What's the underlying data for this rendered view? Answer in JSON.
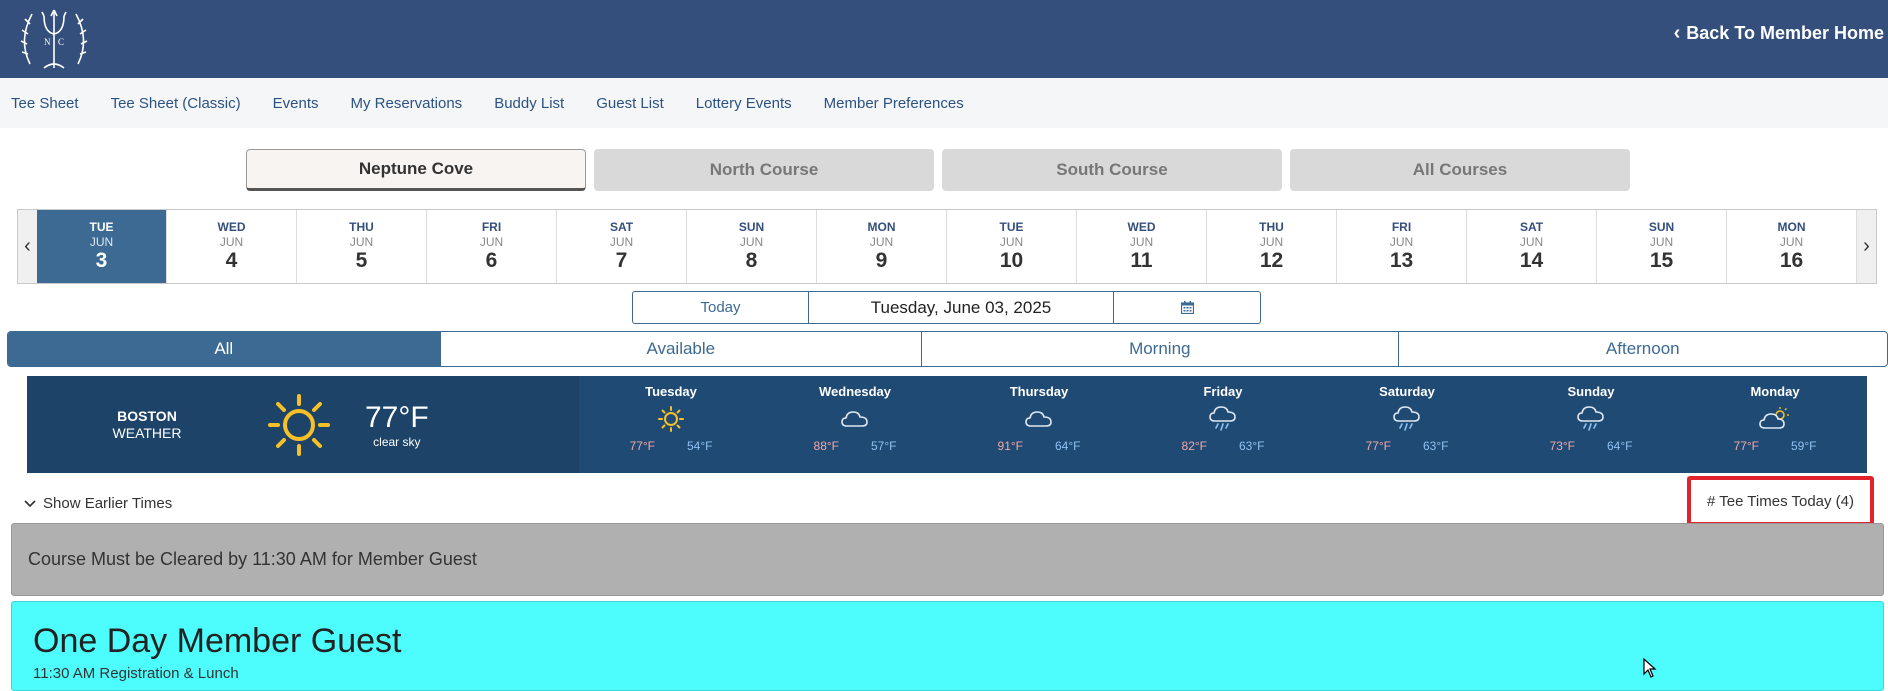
{
  "header": {
    "back_label": "Back To Member Home"
  },
  "nav": [
    "Tee Sheet",
    "Tee Sheet (Classic)",
    "Events",
    "My Reservations",
    "Buddy List",
    "Guest List",
    "Lottery Events",
    "Member Preferences"
  ],
  "courses": [
    "Neptune Cove",
    "North Course",
    "South Course",
    "All Courses"
  ],
  "days": [
    {
      "dow": "TUE",
      "mon": "JUN",
      "num": "3"
    },
    {
      "dow": "WED",
      "mon": "JUN",
      "num": "4"
    },
    {
      "dow": "THU",
      "mon": "JUN",
      "num": "5"
    },
    {
      "dow": "FRI",
      "mon": "JUN",
      "num": "6"
    },
    {
      "dow": "SAT",
      "mon": "JUN",
      "num": "7"
    },
    {
      "dow": "SUN",
      "mon": "JUN",
      "num": "8"
    },
    {
      "dow": "MON",
      "mon": "JUN",
      "num": "9"
    },
    {
      "dow": "TUE",
      "mon": "JUN",
      "num": "10"
    },
    {
      "dow": "WED",
      "mon": "JUN",
      "num": "11"
    },
    {
      "dow": "THU",
      "mon": "JUN",
      "num": "12"
    },
    {
      "dow": "FRI",
      "mon": "JUN",
      "num": "13"
    },
    {
      "dow": "SAT",
      "mon": "JUN",
      "num": "14"
    },
    {
      "dow": "SUN",
      "mon": "JUN",
      "num": "15"
    },
    {
      "dow": "MON",
      "mon": "JUN",
      "num": "16"
    }
  ],
  "datepicker": {
    "today_label": "Today",
    "date_value": "Tuesday, June 03, 2025"
  },
  "filters": [
    "All",
    "Available",
    "Morning",
    "Afternoon"
  ],
  "weather": {
    "city": "BOSTON",
    "label": "WEATHER",
    "temp": "77°F",
    "desc": "clear sky",
    "forecast": [
      {
        "day": "Tuesday",
        "icon": "sun-icon",
        "hi": "77°F",
        "lo": "54°F"
      },
      {
        "day": "Wednesday",
        "icon": "cloud-icon",
        "hi": "88°F",
        "lo": "57°F"
      },
      {
        "day": "Thursday",
        "icon": "cloud-icon",
        "hi": "91°F",
        "lo": "64°F"
      },
      {
        "day": "Friday",
        "icon": "rain-cloud-icon",
        "hi": "82°F",
        "lo": "63°F"
      },
      {
        "day": "Saturday",
        "icon": "rain-cloud-icon",
        "hi": "77°F",
        "lo": "63°F"
      },
      {
        "day": "Sunday",
        "icon": "rain-cloud-icon",
        "hi": "73°F",
        "lo": "64°F"
      },
      {
        "day": "Monday",
        "icon": "partly-cloudy-icon",
        "hi": "77°F",
        "lo": "59°F"
      }
    ]
  },
  "show_earlier_label": "Show Earlier Times",
  "tee_times_label": "# Tee Times Today (4)",
  "notice_text": "Course Must be Cleared by 11:30 AM for Member Guest",
  "event": {
    "title": "One Day Member Guest",
    "subtitle": "11:30 AM Registration & Lunch"
  },
  "colors": {
    "header": "#344f7c",
    "selected": "#3d6a93",
    "weather_bg": "#1f4a74",
    "event_bg": "#4dfcfc",
    "highlight": "#e0242c"
  }
}
